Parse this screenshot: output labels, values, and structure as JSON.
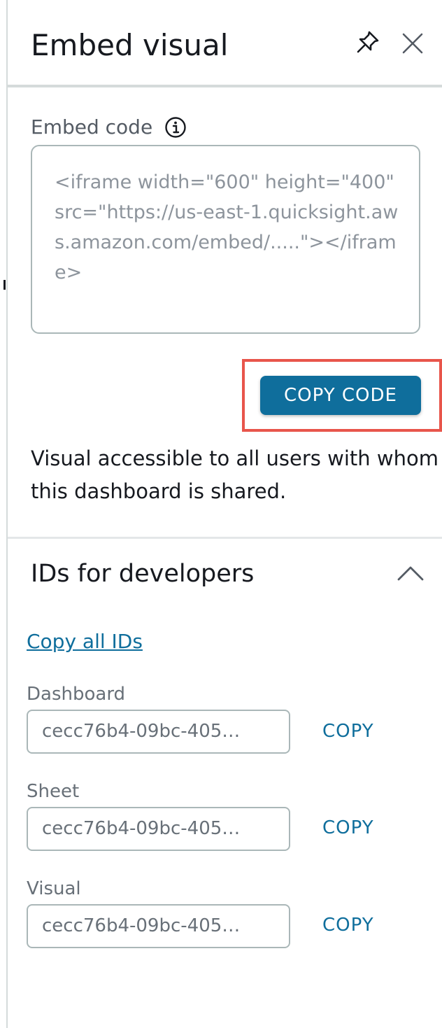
{
  "header": {
    "title": "Embed visual",
    "pin_icon": "pin-icon",
    "close_icon": "close-icon"
  },
  "embed": {
    "label": "Embed code",
    "info_icon": "info-icon",
    "code_placeholder": "<iframe width=\"600\" height=\"400\" src=\"https://us-east-1.quicksight.aws.amazon.com/embed/.....\"></iframe>",
    "copy_code_label": "COPY CODE",
    "access_note_line1": "Visual accessible to all users with whom",
    "access_note_line2": "this dashboard is shared."
  },
  "developers": {
    "title": "IDs for developers",
    "chevron_icon": "chevron-up-icon",
    "copy_all_label": "Copy all IDs",
    "fields": [
      {
        "label": "Dashboard",
        "value": "cecc76b4-09bc-405…",
        "copy_label": "COPY"
      },
      {
        "label": "Sheet",
        "value": "cecc76b4-09bc-405…",
        "copy_label": "COPY"
      },
      {
        "label": "Visual",
        "value": "cecc76b4-09bc-405…",
        "copy_label": "COPY"
      }
    ]
  },
  "colors": {
    "accent": "#0f6e9c",
    "highlight": "#e8554b",
    "border": "#aab7b8",
    "text": "#16191f",
    "muted": "#687078"
  }
}
